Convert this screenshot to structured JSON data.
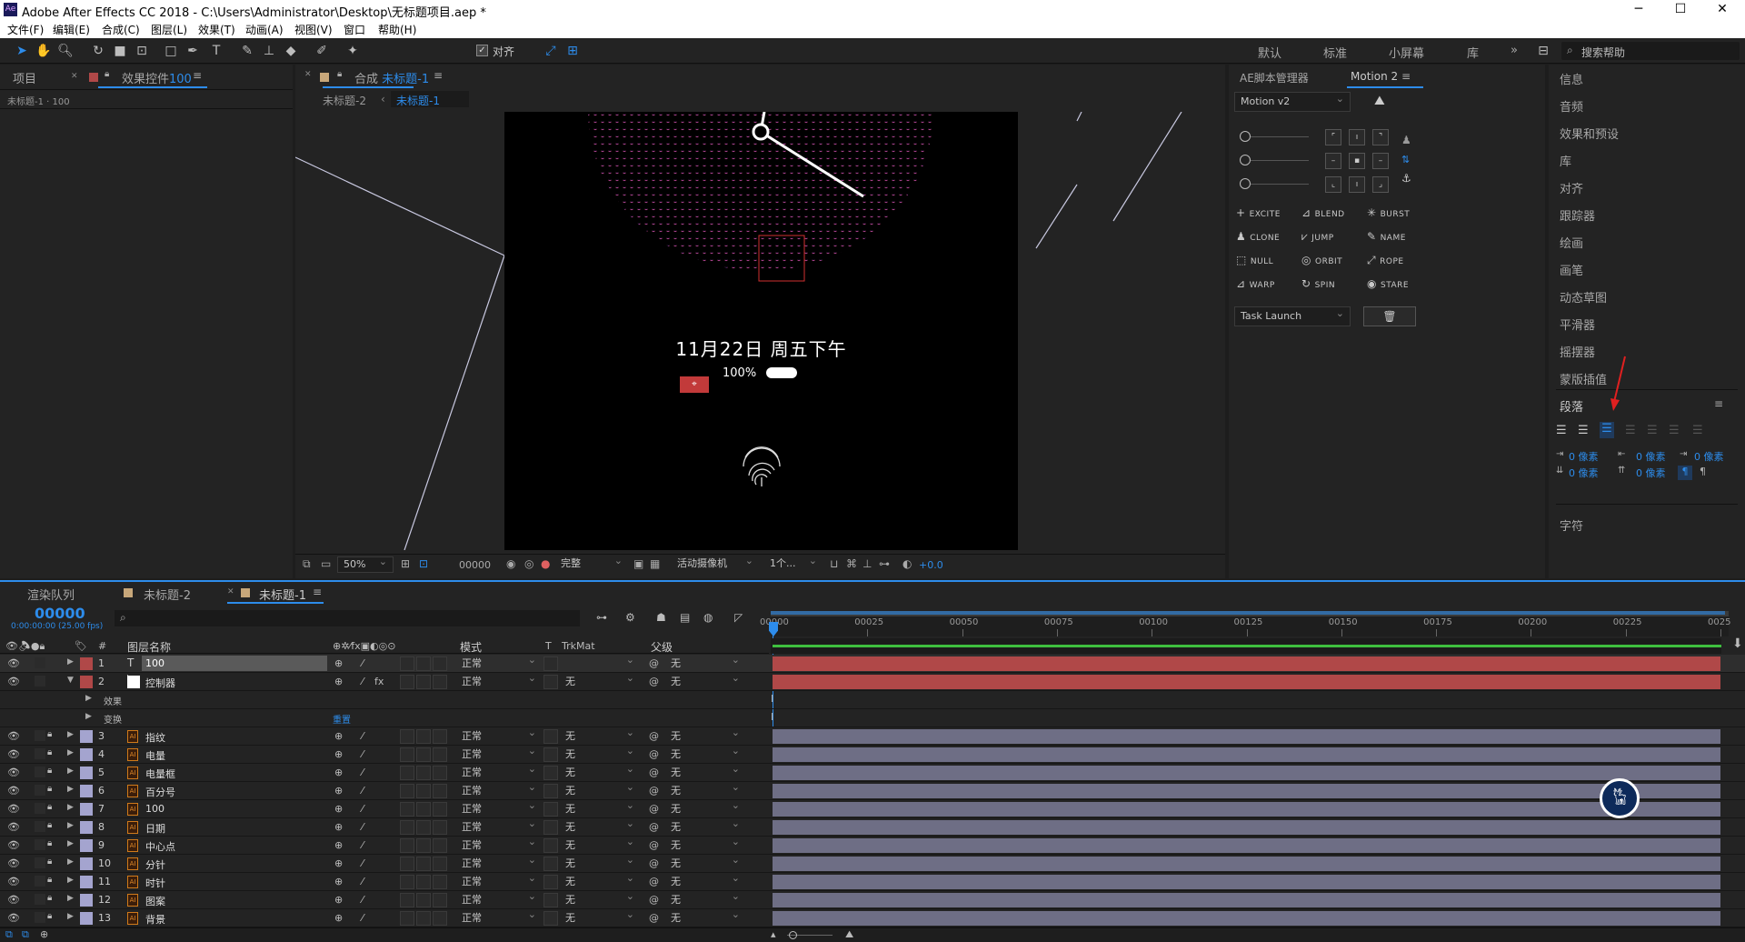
{
  "window": {
    "title": "Adobe After Effects CC 2018 - C:\\Users\\Administrator\\Desktop\\无标题项目.aep *",
    "app_icon": "Ae",
    "minimize": "─",
    "maximize": "☐",
    "close": "✕"
  },
  "menu": [
    "文件(F)",
    "编辑(E)",
    "合成(C)",
    "图层(L)",
    "效果(T)",
    "动画(A)",
    "视图(V)",
    "窗口",
    "帮助(H)"
  ],
  "toolbar": {
    "align_label": "对齐",
    "workspaces": [
      "默认",
      "标准",
      "小屏幕",
      "库"
    ],
    "more": "»",
    "search_placeholder": "搜索帮助"
  },
  "project_panel": {
    "tab_project": "项目",
    "tab_effects": "效果控件",
    "effects_target": "100",
    "subtitle": "未标题-1 · 100"
  },
  "comp_panel": {
    "tab_label": "合成",
    "tab_name": "未标题-1",
    "crumb1": "未标题-2",
    "crumb2": "未标题-1",
    "viewer_date": "11月22日 周五下午",
    "viewer_battery": "100%",
    "zoom": "50%",
    "timecode": "00000",
    "resolution": "完整",
    "camera": "活动摄像机",
    "views": "1个...",
    "exposure": "+0.0"
  },
  "script_panel": {
    "tab_manager": "AE脚本管理器",
    "tab_motion": "Motion 2",
    "version": "Motion v2",
    "buttons": [
      "EXCITE",
      "BLEND",
      "BURST",
      "CLONE",
      "JUMP",
      "NAME",
      "NULL",
      "ORBIT",
      "ROPE",
      "WARP",
      "SPIN",
      "STARE"
    ],
    "task": "Task Launch"
  },
  "right_panel": {
    "items": [
      "信息",
      "音频",
      "效果和预设",
      "库",
      "对齐",
      "跟踪器",
      "绘画",
      "画笔",
      "动态草图",
      "平滑器",
      "摇摆器",
      "蒙版插值"
    ],
    "paragraph_title": "段落",
    "px_value": "0 像素",
    "chars_title": "字符"
  },
  "timeline": {
    "tab_render": "渲染队列",
    "tab_comp2": "未标题-2",
    "tab_comp1": "未标题-1",
    "timecode": "00000",
    "fps": "0:00:00:00 (25.00 fps)",
    "col_name": "图层名称",
    "col_mode": "模式",
    "col_t": "T",
    "col_trkmat": "TrkMat",
    "col_parent": "父级",
    "ticks": [
      "00000",
      "00025",
      "00050",
      "00075",
      "00100",
      "00125",
      "00150",
      "00175",
      "00200",
      "00225",
      "0025"
    ],
    "sub_effects": "效果",
    "sub_transform": "变换",
    "reset": "重置",
    "layers": [
      {
        "num": "1",
        "name": "100",
        "mode": "正常",
        "trk": "",
        "parent": "无",
        "type": "T",
        "color": "#b04848"
      },
      {
        "num": "2",
        "name": "控制器",
        "mode": "正常",
        "trk": "无",
        "parent": "无",
        "type": "■",
        "color": "#b04848"
      },
      {
        "num": "3",
        "name": "指纹",
        "mode": "正常",
        "trk": "无",
        "parent": "无",
        "type": "AI",
        "color": "#a4a4cf"
      },
      {
        "num": "4",
        "name": "电量",
        "mode": "正常",
        "trk": "无",
        "parent": "无",
        "type": "AI",
        "color": "#a4a4cf"
      },
      {
        "num": "5",
        "name": "电量框",
        "mode": "正常",
        "trk": "无",
        "parent": "无",
        "type": "AI",
        "color": "#a4a4cf"
      },
      {
        "num": "6",
        "name": "百分号",
        "mode": "正常",
        "trk": "无",
        "parent": "无",
        "type": "AI",
        "color": "#a4a4cf"
      },
      {
        "num": "7",
        "name": "100",
        "mode": "正常",
        "trk": "无",
        "parent": "无",
        "type": "AI",
        "color": "#a4a4cf"
      },
      {
        "num": "8",
        "name": "日期",
        "mode": "正常",
        "trk": "无",
        "parent": "无",
        "type": "AI",
        "color": "#a4a4cf"
      },
      {
        "num": "9",
        "name": "中心点",
        "mode": "正常",
        "trk": "无",
        "parent": "无",
        "type": "AI",
        "color": "#a4a4cf"
      },
      {
        "num": "10",
        "name": "分针",
        "mode": "正常",
        "trk": "无",
        "parent": "无",
        "type": "AI",
        "color": "#a4a4cf"
      },
      {
        "num": "11",
        "name": "时针",
        "mode": "正常",
        "trk": "无",
        "parent": "无",
        "type": "AI",
        "color": "#a4a4cf"
      },
      {
        "num": "12",
        "name": "图案",
        "mode": "正常",
        "trk": "无",
        "parent": "无",
        "type": "AI",
        "color": "#a4a4cf"
      },
      {
        "num": "13",
        "name": "背景",
        "mode": "正常",
        "trk": "无",
        "parent": "无",
        "type": "AI",
        "color": "#a4a4cf"
      }
    ]
  },
  "colors": {
    "accent": "#2d8ceb",
    "red_bar": "#b04848",
    "layer_bar": "#6e6e85",
    "panel": "#232323"
  }
}
